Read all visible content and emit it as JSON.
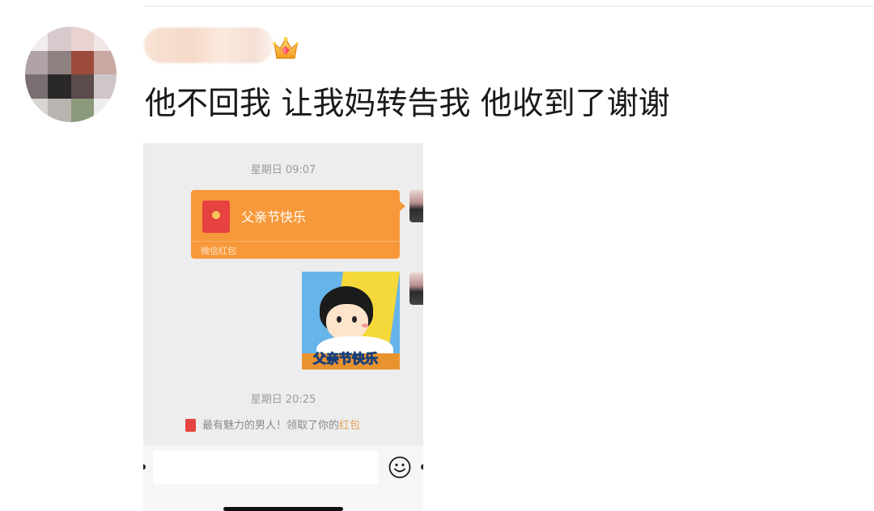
{
  "comment": {
    "text": "他不回我 让我妈转告我 他收到了谢谢"
  },
  "chat": {
    "timestamp_1": "星期日 09:07",
    "red_packet": {
      "title": "父亲节快乐",
      "footer": "微信红包"
    },
    "sticker_text": "父亲节快乐",
    "timestamp_2": "星期日 20:25",
    "system_message": {
      "text": "最有魅力的男人！领取了你的",
      "highlight": "红包"
    }
  },
  "colors": {
    "red_packet_bg": "#f7993a",
    "chat_bg": "#ededed",
    "highlight": "#e8a25c"
  },
  "icons": {
    "crown": "crown-icon",
    "emoji": "emoji-icon",
    "red_packet": "red-packet-icon"
  }
}
